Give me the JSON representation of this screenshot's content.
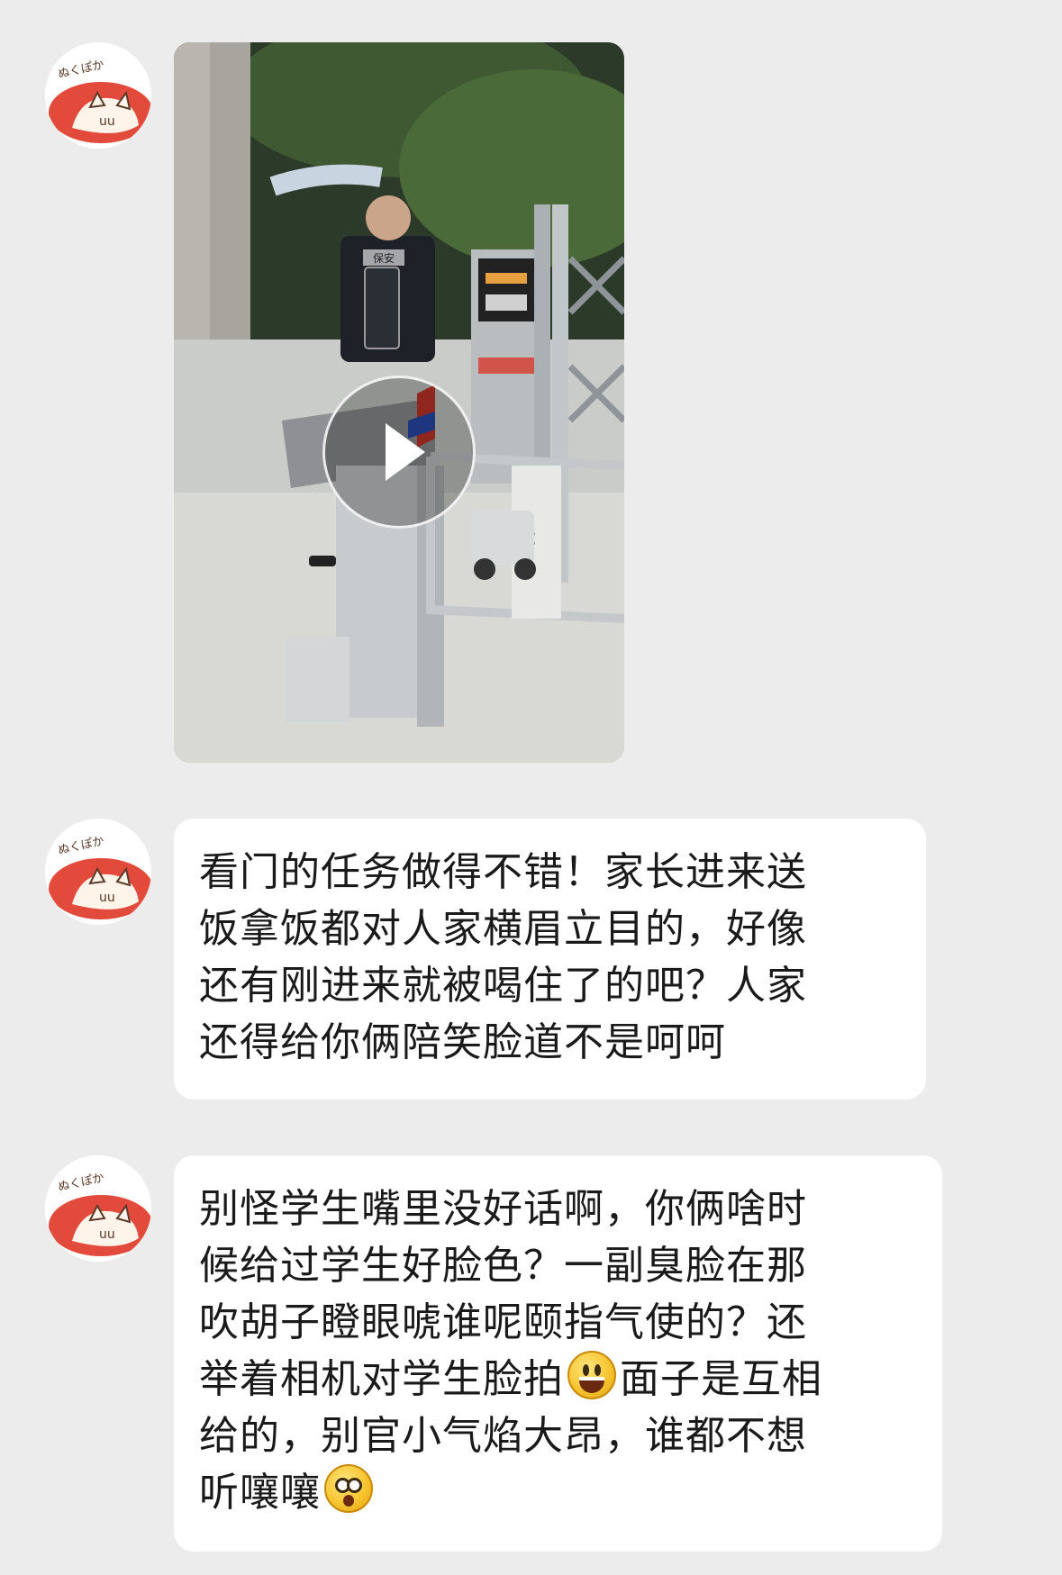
{
  "chat": {
    "sender": {
      "avatar_icon": "cat-sticker-avatar-icon",
      "avatar_text": "ぬくぽか"
    },
    "messages": [
      {
        "type": "video",
        "thumbnail_icon": "video-thumbnail-turnstile-guard",
        "play_icon": "play-icon",
        "jacket_text": "保安"
      },
      {
        "type": "text",
        "lines": [
          "看门的任务做得不错！家长进来送",
          "饭拿饭都对人家横眉立目的，好像",
          "还有刚进来就被喝住了的吧？人家",
          "还得给你俩陪笑脸道不是呵呵"
        ]
      },
      {
        "type": "text",
        "lines": [
          "别怪学生嘴里没好话啊，你俩啥时",
          "候给过学生好脸色？一副臭脸在那",
          "吹胡子瞪眼唬谁呢颐指气使的？还",
          "举着相机对学生脸拍",
          "面子是互相",
          "给的，别官小气焰大昂，谁都不想",
          "听嚷嚷"
        ],
        "emojis": [
          "grinning-face-emoji",
          "astonished-face-emoji"
        ]
      }
    ]
  }
}
